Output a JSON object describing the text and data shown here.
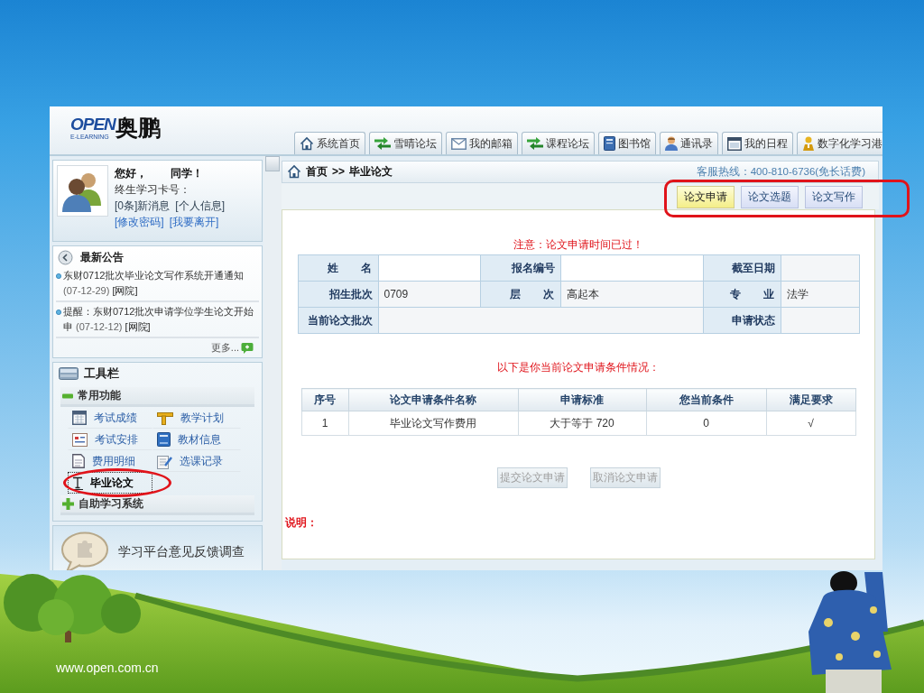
{
  "header": {
    "logo": {
      "wordmark": "OPEN",
      "tagline": "E-LEARNING",
      "name": "奥鹏"
    },
    "nav_tabs": [
      "系统首页",
      "雪晴论坛",
      "我的邮箱",
      "课程论坛",
      "图书馆",
      "通讯录",
      "我的日程",
      "数字化学习港"
    ]
  },
  "user_panel": {
    "greeting": "您好，",
    "title": "同学！",
    "card_label": "终生学习卡号：",
    "message_links": [
      "[0条]新消息",
      "[个人信息]"
    ],
    "account_links": [
      "[修改密码]",
      "[我要离开]"
    ]
  },
  "announcements": {
    "title": "最新公告",
    "items": [
      {
        "text": "东财0712批次毕业论文写作系统开通通知",
        "date": "(07-12-29)",
        "source": "[网院]"
      },
      {
        "text": "提醒：东财0712批次申请学位学生论文开始申",
        "date": "(07-12-12)",
        "source": "[网院]"
      }
    ],
    "more": "更多..."
  },
  "toolbar": {
    "title": "工具栏",
    "groups": [
      {
        "label": "常用功能",
        "expanded": true,
        "items": [
          {
            "label": "考试成绩",
            "selected": false,
            "circled": false
          },
          {
            "label": "教学计划",
            "selected": false,
            "circled": false
          },
          {
            "label": "考试安排",
            "selected": false,
            "circled": false
          },
          {
            "label": "教材信息",
            "selected": false,
            "circled": false
          },
          {
            "label": "费用明细",
            "selected": false,
            "circled": false
          },
          {
            "label": "选课记录",
            "selected": false,
            "circled": false
          },
          {
            "label": "毕业论文",
            "selected": true,
            "circled": true
          }
        ]
      },
      {
        "label": "自助学习系统",
        "expanded": false
      }
    ]
  },
  "feedback_banner": {
    "text": "学习平台意见反馈调查"
  },
  "breadcrumb": {
    "home": "首页",
    "separator": ">>",
    "current": "毕业论文"
  },
  "hotline": "客服热线：400-810-6736(免长话费)",
  "sub_tabs": {
    "circled": true,
    "items": [
      {
        "label": "论文申请",
        "selected": true
      },
      {
        "label": "论文选题",
        "selected": false
      },
      {
        "label": "论文写作",
        "selected": false
      }
    ]
  },
  "notice": "注意：论文申请时间已过！",
  "info_table": {
    "rows": [
      [
        {
          "kind": "label",
          "text": "姓 名"
        },
        {
          "kind": "value",
          "text": "",
          "redacted": true
        },
        {
          "kind": "label",
          "text": "报名编号"
        },
        {
          "kind": "value",
          "text": "",
          "redacted": true
        },
        {
          "kind": "label",
          "text": "截至日期"
        },
        {
          "kind": "value",
          "text": ""
        }
      ],
      [
        {
          "kind": "label",
          "text": "招生批次"
        },
        {
          "kind": "value",
          "text": "0709"
        },
        {
          "kind": "label",
          "text": "层 次"
        },
        {
          "kind": "value",
          "text": "高起本"
        },
        {
          "kind": "label",
          "text": "专 业"
        },
        {
          "kind": "value",
          "text": "法学"
        }
      ],
      [
        {
          "kind": "label",
          "text": "当前论文批次"
        },
        {
          "kind": "value",
          "text": ""
        },
        {
          "kind": "value",
          "text": "",
          "joined": true
        },
        {
          "kind": "value",
          "text": "",
          "joined": true
        },
        {
          "kind": "label",
          "text": "申请状态"
        },
        {
          "kind": "value",
          "text": ""
        }
      ]
    ]
  },
  "conditions_intro": "以下是你当前论文申请条件情况：",
  "conditions_table": {
    "columns": [
      "序号",
      "论文申请条件名称",
      "申请标准",
      "您当前条件",
      "满足要求"
    ],
    "rows": [
      [
        "1",
        "毕业论文写作费用",
        "大于等于 720",
        "0",
        "√"
      ]
    ]
  },
  "actions": [
    {
      "label": "提交论文申请",
      "disabled": true
    },
    {
      "label": "取消论文申请",
      "disabled": true
    }
  ],
  "note_label": "说明：",
  "slide": {
    "footer": "www.open.com.cn"
  }
}
